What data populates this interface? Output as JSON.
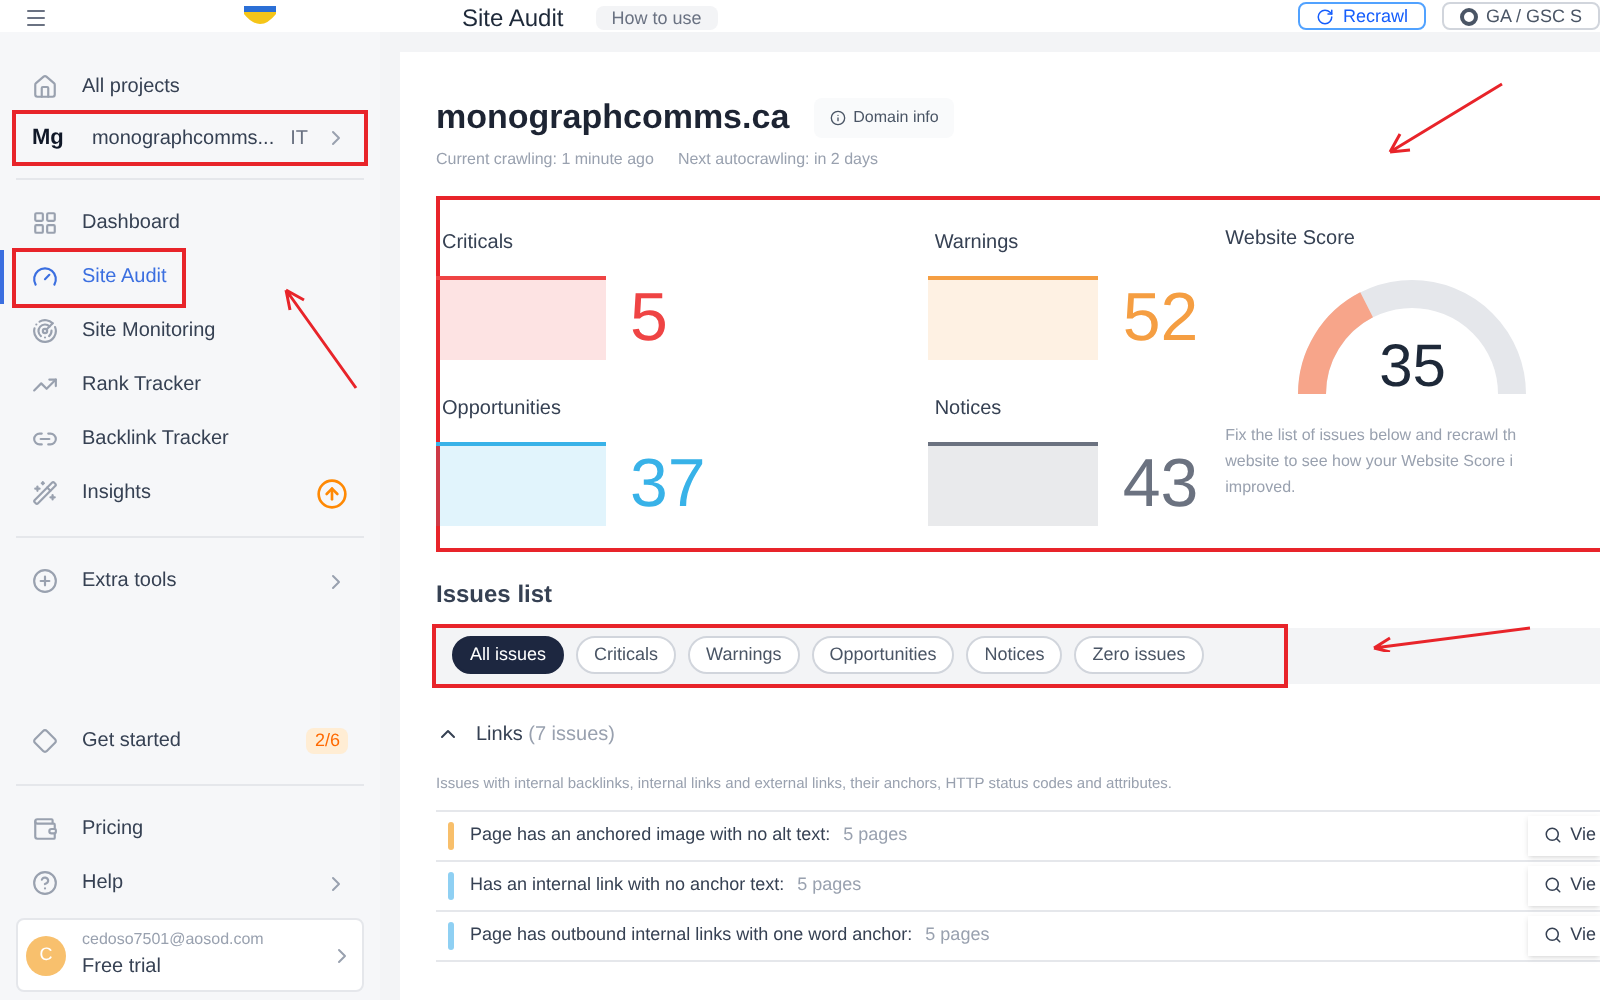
{
  "top_bar": {
    "page_title": "Site Audit",
    "help_button": "How to use",
    "actions": [
      "Recrawl",
      "GA / GSC S"
    ]
  },
  "sidebar": {
    "items": [
      {
        "kind": "link",
        "label": "All projects",
        "selected": false
      },
      {
        "kind": "project",
        "badge": "Mg",
        "label": "monographcomms...",
        "tag": "IT",
        "highlighted": true
      },
      {
        "kind": "divider"
      },
      {
        "kind": "link",
        "label": "Dashboard",
        "selected": false
      },
      {
        "kind": "link",
        "label": "Site Audit",
        "selected": true,
        "highlighted": true
      },
      {
        "kind": "link",
        "label": "Site Monitoring",
        "selected": false
      },
      {
        "kind": "link",
        "label": "Rank Tracker",
        "selected": false
      },
      {
        "kind": "link",
        "label": "Backlink Tracker",
        "selected": false
      },
      {
        "kind": "upgrade",
        "label": "Insights",
        "selected": false
      },
      {
        "kind": "divider"
      },
      {
        "kind": "submenu",
        "label": "Extra tools",
        "selected": false
      },
      {
        "kind": "spacer"
      },
      {
        "kind": "link",
        "label": "Get started",
        "selected": false,
        "count": "2/6"
      },
      {
        "kind": "divider"
      },
      {
        "kind": "link",
        "label": "Pricing",
        "selected": false
      },
      {
        "kind": "submenu",
        "label": "Help",
        "selected": false
      }
    ],
    "account": {
      "initial": "C",
      "email": "cedoso7501@aosod.com",
      "plan": "Free trial"
    }
  },
  "site": {
    "domain": "monographcomms.ca",
    "domain_button": "Domain info",
    "current_crawling": "Current crawling: 1 minute ago",
    "next_crawling": "Next autocrawling: in 2 days"
  },
  "stats": [
    {
      "label": "Criticals",
      "value": "5",
      "color": "#ef4444"
    },
    {
      "label": "Warnings",
      "value": "52",
      "color": "#f59e42"
    },
    {
      "label": "Opportunities",
      "value": "37",
      "color": "#38b2e8"
    },
    {
      "label": "Notices",
      "value": "43",
      "color": "#6b7280"
    }
  ],
  "score": {
    "title": "Website Score",
    "value": "35",
    "hint_lines": [
      "Fix the list of issues below and recrawl th",
      "website to see how your Website Score i",
      "improved."
    ]
  },
  "issues": {
    "title": "Issues list",
    "filters": [
      {
        "label": "All issues",
        "selected": true
      },
      {
        "label": "Criticals",
        "selected": false
      },
      {
        "label": "Warnings",
        "selected": false
      },
      {
        "label": "Opportunities",
        "selected": false
      },
      {
        "label": "Notices",
        "selected": false
      },
      {
        "label": "Zero issues",
        "selected": false
      }
    ],
    "group": {
      "name": "Links",
      "count": "(7 issues)",
      "expanded": true,
      "description": "Issues with internal backlinks, internal links and external links, their anchors, HTTP status codes and attributes."
    },
    "rows": [
      {
        "text": "Page has an anchored image with no alt text:",
        "pages": "5 pages",
        "color": "#f8bf6b",
        "action": "Vie"
      },
      {
        "text": "Has an internal link with no anchor text:",
        "pages": "5 pages",
        "color": "#8fd0f3",
        "action": "Vie"
      },
      {
        "text": "Page has outbound internal links with one word anchor:",
        "pages": "5 pages",
        "color": "#8fd0f3",
        "action": "Vie"
      }
    ]
  }
}
